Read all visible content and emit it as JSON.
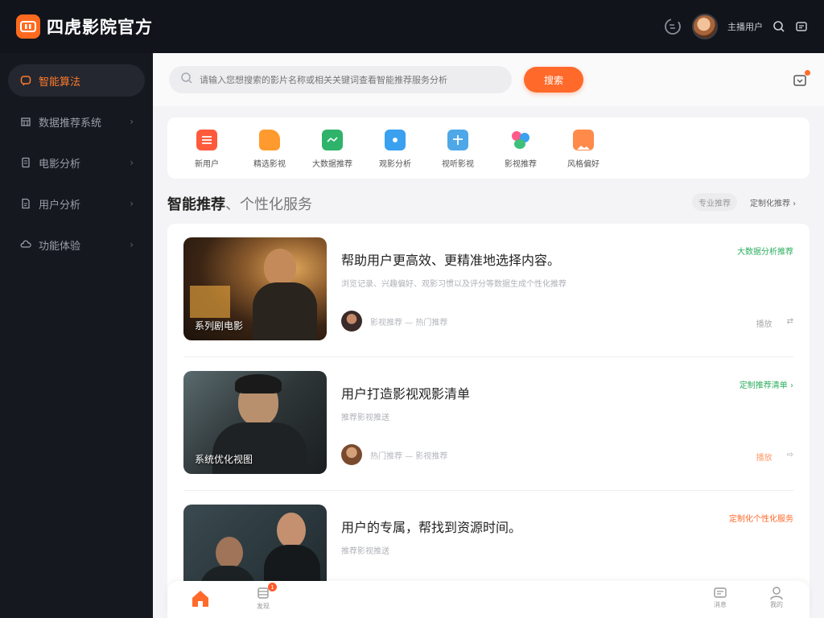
{
  "colors": {
    "accent": "#ff6a2b",
    "sidebar_bg": "#16181f",
    "topbar_bg": "#12141b",
    "green_tag": "#2eae5f",
    "orange_tag": "#ff6a2b"
  },
  "header": {
    "brand": "四虎影院官方",
    "username": "主播用户",
    "icons": [
      "logo-icon",
      "refresh-icon",
      "search-icon",
      "message-icon"
    ]
  },
  "sidebar": {
    "items": [
      {
        "label": "智能算法",
        "icon": "chat-icon",
        "active": true
      },
      {
        "label": "数据推荐系统",
        "icon": "building-icon",
        "active": false
      },
      {
        "label": "电影分析",
        "icon": "document-icon",
        "active": false
      },
      {
        "label": "用户分析",
        "icon": "file-icon",
        "active": false
      },
      {
        "label": "功能体验",
        "icon": "cloud-icon",
        "active": false
      }
    ]
  },
  "search": {
    "placeholder": "请输入您想搜索的影片名称或相关关键词查看智能推荐服务分析",
    "button": "搜索"
  },
  "categories": [
    {
      "label": "新用户",
      "icon": "list-icon",
      "color": "#ff5a3c"
    },
    {
      "label": "精选影视",
      "icon": "puzzle-icon",
      "color": "#ff9a2e"
    },
    {
      "label": "大数据推荐",
      "icon": "folder-icon",
      "color": "#2fb36a"
    },
    {
      "label": "观影分析",
      "icon": "camera-icon",
      "color": "#3aa0f0"
    },
    {
      "label": "视听影视",
      "icon": "gift-icon",
      "color": "#4ea8e8"
    },
    {
      "label": "影视推荐",
      "icon": "shapes-icon",
      "color": "#3ebf7a"
    },
    {
      "label": "风格偏好",
      "icon": "picture-icon",
      "color": "#ff8a4a"
    }
  ],
  "section": {
    "title_bold": "智能推荐",
    "title_light": "、个性化服务",
    "chip": "专业推荐",
    "more": "定制化推荐 ›"
  },
  "cards": [
    {
      "thumb_caption": "系列剧电影",
      "title": "帮助用户更高效、更精准地选择内容。",
      "desc": "浏览记录、兴趣偏好、观影习惯以及评分等数据生成个性化推荐",
      "author": "影视推荐 — 热门推荐",
      "tag": "大数据分析推荐",
      "tag_color": "#2eae5f",
      "action": "播放"
    },
    {
      "thumb_caption": "系统优化视图",
      "title": "用户打造影视观影清单",
      "desc": "推荐影视推送",
      "author": "热门推荐 — 影视推荐",
      "tag": "定制推荐清单 ›",
      "tag_color": "#2eae5f",
      "action": "播放"
    },
    {
      "thumb_caption": "",
      "title": "用户的专属，帮找到资源时间。",
      "desc": "推荐影视推送",
      "author": "",
      "tag": "定制化个性化服务",
      "tag_color": "#ff6a2b",
      "action": ""
    }
  ],
  "bottomnav": [
    {
      "label": "",
      "icon": "home-icon",
      "active": true
    },
    {
      "label": "发现",
      "icon": "discover-icon",
      "badge": "1"
    },
    {
      "label": "消息",
      "icon": "message-icon"
    },
    {
      "label": "我的",
      "icon": "user-icon"
    }
  ]
}
